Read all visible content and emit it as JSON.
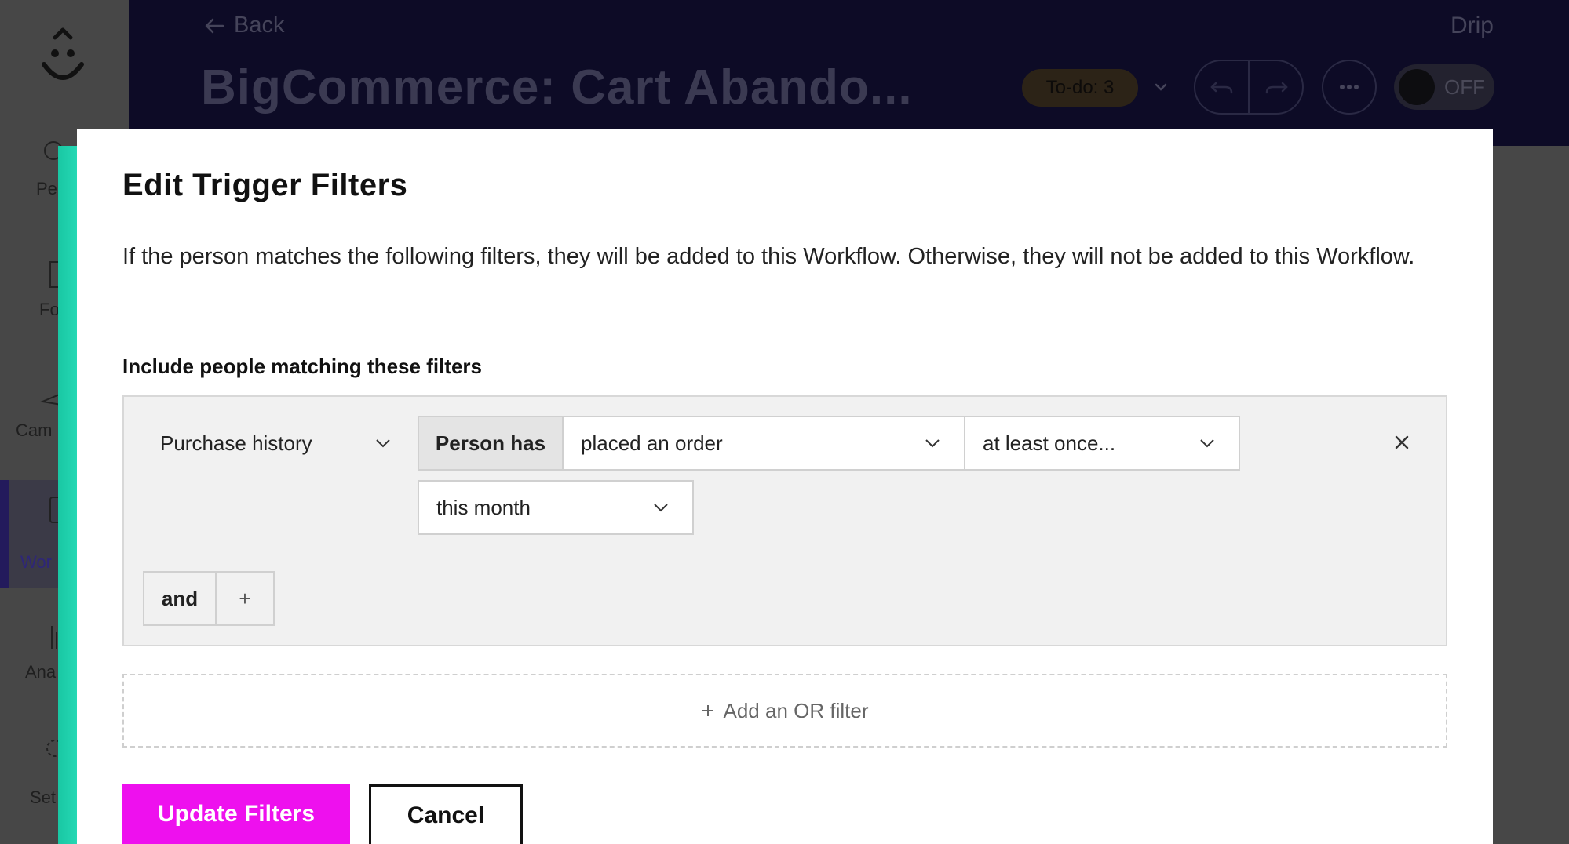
{
  "sidebar": {
    "items": [
      {
        "label": "Pe",
        "icon": "people-icon"
      },
      {
        "label": "Fo",
        "icon": "forms-icon"
      },
      {
        "label": "Cam",
        "icon": "campaigns-icon"
      },
      {
        "label": "Wor",
        "icon": "workflows-icon",
        "active": true
      },
      {
        "label": "Ana",
        "icon": "analytics-icon"
      },
      {
        "label": "Set",
        "icon": "settings-icon"
      }
    ]
  },
  "header": {
    "back_label": "Back",
    "brand": "Drip",
    "title": "BigCommerce: Cart Abando...",
    "todo_label": "To-do: 3",
    "toggle_label": "OFF"
  },
  "modal": {
    "title": "Edit Trigger Filters",
    "description": "If the person matches the following filters, they will be added to this Workflow. Otherwise, they will not be added to this Workflow.",
    "section_label": "Include people matching these filters",
    "filter": {
      "field": "Purchase history",
      "operator_label": "Person has",
      "action": "placed an order",
      "frequency": "at least once...",
      "period": "this month"
    },
    "and_label": "and",
    "plus_label": "+",
    "or_filter_label": "Add an OR filter",
    "primary_button": "Update Filters",
    "secondary_button": "Cancel"
  },
  "colors": {
    "accent": "#1fd0ab",
    "primary_button": "#ee10ee",
    "header_bg": "#0d0b26"
  }
}
